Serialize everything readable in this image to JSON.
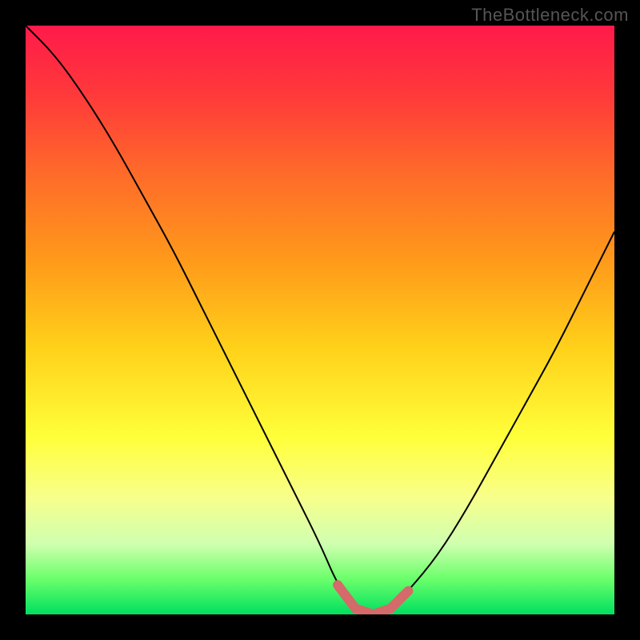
{
  "watermark": "TheBottleneck.com",
  "chart_data": {
    "type": "line",
    "title": "",
    "xlabel": "",
    "ylabel": "",
    "x": [
      0.0,
      0.05,
      0.1,
      0.15,
      0.2,
      0.25,
      0.3,
      0.35,
      0.4,
      0.45,
      0.5,
      0.53,
      0.56,
      0.59,
      0.62,
      0.65,
      0.7,
      0.75,
      0.8,
      0.85,
      0.9,
      0.95,
      1.0
    ],
    "values": [
      1.0,
      0.95,
      0.88,
      0.8,
      0.71,
      0.62,
      0.52,
      0.42,
      0.32,
      0.22,
      0.12,
      0.05,
      0.01,
      0.0,
      0.01,
      0.04,
      0.1,
      0.18,
      0.27,
      0.36,
      0.45,
      0.55,
      0.65
    ],
    "highlight_segment_x": [
      0.53,
      0.65
    ],
    "xlim": [
      0,
      1
    ],
    "ylim": [
      0,
      1
    ],
    "legend": [],
    "grid": false,
    "colors": {
      "curve": "#000000",
      "highlight": "#d46a6a",
      "gradient_top": "#ff1a4a",
      "gradient_bottom": "#00e060"
    }
  }
}
